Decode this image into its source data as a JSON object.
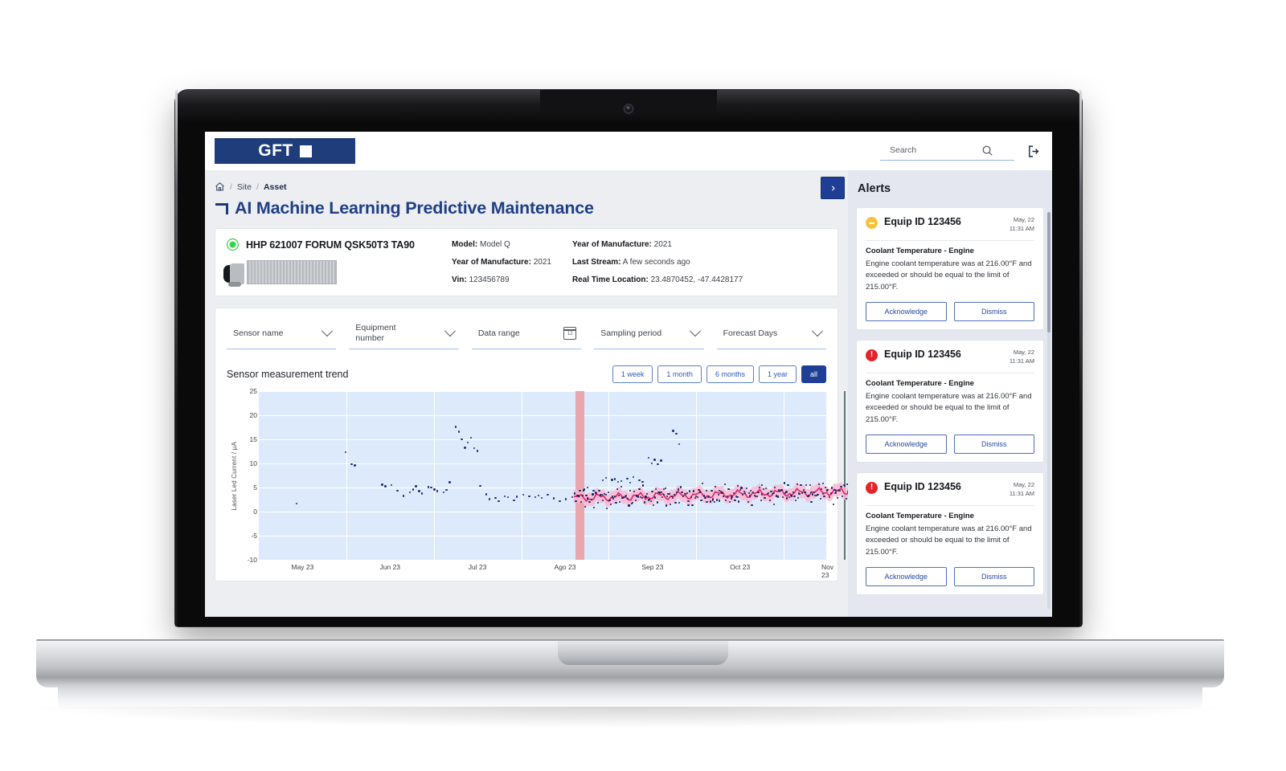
{
  "brand": {
    "name": "GFT",
    "logo_square": "■",
    "primary": "#1f3d7a",
    "accent": "#1f3f96"
  },
  "header": {
    "search": {
      "placeholder": "Search",
      "value": ""
    },
    "search_icon": "search-icon",
    "logout_icon": "logout-icon"
  },
  "breadcrumb": {
    "home_icon": "home-icon",
    "sep": "/",
    "items": [
      "Site",
      "Asset"
    ]
  },
  "page": {
    "title": "AI Machine Learning Predictive Maintenance"
  },
  "asset": {
    "status": "online",
    "status_color": "#36d44b",
    "name": "HHP 621007 FORUM QSK50T3 TA90",
    "details_left": [
      {
        "label": "Model:",
        "value": "Model Q"
      },
      {
        "label": "Year of  Manufacture:",
        "value": "2021"
      },
      {
        "label": "Vin:",
        "value": "123456789"
      }
    ],
    "details_right": [
      {
        "label": "Year of  Manufacture:",
        "value": "2021"
      },
      {
        "label": "Last Stream:",
        "value": "A few seconds ago"
      },
      {
        "label": "Real Time Location:",
        "value": "23.4870452, -47.4428177"
      }
    ]
  },
  "filters": [
    {
      "label": "Sensor name",
      "icon": "chevron-down-icon",
      "value": ""
    },
    {
      "label": "Equipment\nnumber",
      "icon": "chevron-down-icon",
      "value": ""
    },
    {
      "label": "Data range",
      "icon": "calendar-icon",
      "value": ""
    },
    {
      "label": "Sampling period",
      "icon": "chevron-down-icon",
      "value": ""
    },
    {
      "label": "Forecast Days",
      "icon": "chevron-down-icon",
      "value": ""
    }
  ],
  "filter_labels": {
    "sensor_name": "Sensor name",
    "equipment_number_l1": "Equipment",
    "equipment_number_l2": "number",
    "data_range": "Data range",
    "sampling_period": "Sampling period",
    "forecast_days": "Forecast Days",
    "calendar_day": "12"
  },
  "chart_panel": {
    "title": "Sensor measurement trend",
    "ranges": [
      {
        "label": "1 week",
        "active": false
      },
      {
        "label": "1 month",
        "active": false
      },
      {
        "label": "6 months",
        "active": false
      },
      {
        "label": "1 year",
        "active": false
      },
      {
        "label": "all",
        "active": true
      }
    ]
  },
  "chart_data": {
    "type": "scatter",
    "title": "Sensor measurement trend",
    "xlabel": "",
    "ylabel": "Laser Led Current / µA",
    "ylim": [
      -10,
      25
    ],
    "yticks": [
      25,
      20,
      15,
      10,
      5,
      0,
      -5,
      -10
    ],
    "xticks": [
      "May 23",
      "Jun 23",
      "Jul 23",
      "Ago 23",
      "Sep 23",
      "Oct 23",
      "Nov 23"
    ],
    "grid": true,
    "plot_bg": "#ddeafb",
    "legend": "none",
    "series": [
      {
        "name": "Measured samples",
        "type": "scatter",
        "color": "#1b2f7a",
        "points": [
          [
            0.06,
            1.7
          ],
          [
            0.14,
            12.4
          ],
          [
            0.15,
            9.9
          ],
          [
            0.155,
            9.6
          ],
          [
            0.2,
            5.6
          ],
          [
            0.205,
            5.3
          ],
          [
            0.215,
            5.5
          ],
          [
            0.225,
            4.4
          ],
          [
            0.235,
            3.3
          ],
          [
            0.245,
            4.0
          ],
          [
            0.25,
            4.6
          ],
          [
            0.255,
            5.3
          ],
          [
            0.26,
            4.3
          ],
          [
            0.265,
            3.8
          ],
          [
            0.275,
            5.1
          ],
          [
            0.28,
            5.0
          ],
          [
            0.285,
            4.6
          ],
          [
            0.29,
            4.3
          ],
          [
            0.3,
            4.0
          ],
          [
            0.305,
            4.5
          ],
          [
            0.31,
            6.1
          ],
          [
            0.32,
            17.6
          ],
          [
            0.325,
            16.6
          ],
          [
            0.33,
            15.0
          ],
          [
            0.335,
            13.3
          ],
          [
            0.34,
            14.4
          ],
          [
            0.345,
            15.4
          ],
          [
            0.35,
            13.2
          ],
          [
            0.355,
            12.6
          ],
          [
            0.36,
            5.4
          ],
          [
            0.37,
            3.6
          ],
          [
            0.375,
            2.6
          ],
          [
            0.385,
            2.9
          ],
          [
            0.39,
            2.2
          ],
          [
            0.4,
            3.2
          ],
          [
            0.405,
            3.0
          ],
          [
            0.415,
            2.4
          ],
          [
            0.42,
            3.1
          ],
          [
            0.43,
            3.5
          ],
          [
            0.44,
            3.2
          ],
          [
            0.45,
            3.0
          ],
          [
            0.455,
            3.4
          ],
          [
            0.46,
            2.9
          ],
          [
            0.47,
            3.5
          ],
          [
            0.48,
            2.8
          ],
          [
            0.49,
            2.2
          ],
          [
            0.5,
            2.6
          ],
          [
            0.51,
            3.0
          ],
          [
            0.52,
            3.4
          ],
          [
            0.53,
            4.6
          ],
          [
            0.535,
            5.0
          ],
          [
            0.545,
            4.4
          ],
          [
            0.55,
            3.9
          ],
          [
            0.56,
            6.5
          ],
          [
            0.565,
            7.0
          ],
          [
            0.575,
            6.6
          ],
          [
            0.58,
            6.8
          ],
          [
            0.585,
            6.2
          ],
          [
            0.59,
            6.4
          ],
          [
            0.6,
            6.9
          ],
          [
            0.605,
            6.0
          ],
          [
            0.61,
            7.2
          ],
          [
            0.62,
            6.5
          ],
          [
            0.625,
            6.2
          ],
          [
            0.635,
            11.2
          ],
          [
            0.64,
            10.0
          ],
          [
            0.645,
            10.8
          ],
          [
            0.65,
            9.9
          ],
          [
            0.655,
            10.6
          ],
          [
            0.66,
            4.7
          ],
          [
            0.665,
            3.2
          ],
          [
            0.675,
            16.8
          ],
          [
            0.68,
            16.2
          ],
          [
            0.685,
            14.0
          ],
          [
            0.7,
            2.2
          ],
          [
            0.72,
            2.4
          ],
          [
            0.73,
            2.0
          ],
          [
            0.74,
            2.6
          ],
          [
            0.75,
            2.3
          ],
          [
            0.77,
            2.8
          ],
          [
            0.78,
            3.0
          ],
          [
            0.8,
            3.3
          ],
          [
            0.82,
            3.6
          ],
          [
            0.84,
            3.9
          ],
          [
            0.86,
            4.1
          ],
          [
            0.88,
            3.8
          ],
          [
            0.9,
            4.0
          ],
          [
            0.92,
            3.7
          ],
          [
            0.94,
            3.9
          ],
          [
            0.96,
            4.1
          ]
        ]
      },
      {
        "name": "Prediction",
        "type": "line",
        "color": "#d6256b",
        "band_color": "#f9b8d1",
        "band_spread": 1.2,
        "x_start": "Ago 23",
        "x_end": "Nov 23"
      }
    ],
    "annotations": [
      {
        "type": "vspan",
        "label": "anomaly-window",
        "color": "#eaa6ae",
        "x_center": "Ago 23"
      },
      {
        "type": "vline",
        "label": "now-marker",
        "color": "#5d7a74",
        "x": "Nov 23"
      }
    ]
  },
  "alerts": {
    "title": "Alerts",
    "collapse_icon": "chevron-right-icon",
    "items": [
      {
        "severity": "warning",
        "severity_color": "#f5c33b",
        "equip": "Equip ID 123456",
        "date": "May, 22",
        "time": "11:31 AM",
        "subject": "Coolant Temperature - Engine",
        "message": "Engine coolant temperature was at 216.00°F and exceeded or should be equal to the limit of 215.00°F.",
        "actions": [
          "Acknowledge",
          "Dismiss"
        ]
      },
      {
        "severity": "critical",
        "severity_color": "#e6232b",
        "equip": "Equip ID 123456",
        "date": "May, 22",
        "time": "11:31 AM",
        "subject": "Coolant Temperature - Engine",
        "message": "Engine coolant temperature was at 216.00°F and exceeded or should be equal to the limit of 215.00°F.",
        "actions": [
          "Acknowledge",
          "Dismiss"
        ]
      },
      {
        "severity": "critical",
        "severity_color": "#e6232b",
        "equip": "Equip ID 123456",
        "date": "May, 22",
        "time": "11:31 AM",
        "subject": "Coolant Temperature - Engine",
        "message": "Engine coolant temperature was at 216.00°F and exceeded or should be equal to the limit of 215.00°F.",
        "actions": [
          "Acknowledge",
          "Dismiss"
        ]
      }
    ]
  }
}
